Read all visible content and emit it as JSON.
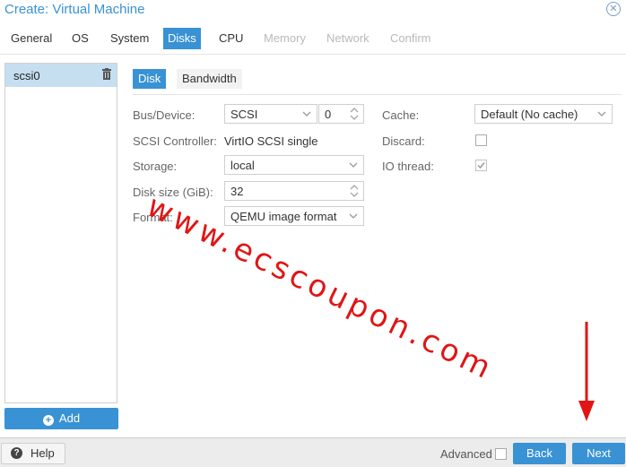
{
  "window": {
    "title": "Create: Virtual Machine",
    "close_icon": "close-icon"
  },
  "tabs": [
    {
      "label": "General",
      "state": "normal"
    },
    {
      "label": "OS",
      "state": "normal"
    },
    {
      "label": "System",
      "state": "normal"
    },
    {
      "label": "Disks",
      "state": "active"
    },
    {
      "label": "CPU",
      "state": "normal"
    },
    {
      "label": "Memory",
      "state": "disabled"
    },
    {
      "label": "Network",
      "state": "disabled"
    },
    {
      "label": "Confirm",
      "state": "disabled"
    }
  ],
  "disk_list": {
    "items": [
      {
        "label": "scsi0",
        "selected": true
      }
    ],
    "delete_icon": "trash-icon",
    "add_label": "Add",
    "add_icon": "plus-circle-icon"
  },
  "subtabs": [
    {
      "label": "Disk",
      "active": true
    },
    {
      "label": "Bandwidth",
      "active": false
    }
  ],
  "form": {
    "bus_device": {
      "label": "Bus/Device:",
      "bus_value": "SCSI",
      "device_value": "0"
    },
    "scsi_controller": {
      "label": "SCSI Controller:",
      "value": "VirtIO SCSI single"
    },
    "storage": {
      "label": "Storage:",
      "value": "local"
    },
    "disk_size": {
      "label": "Disk size (GiB):",
      "value": "32"
    },
    "format": {
      "label": "Format:",
      "value": "QEMU image format"
    },
    "cache": {
      "label": "Cache:",
      "value": "Default (No cache)"
    },
    "discard": {
      "label": "Discard:",
      "checked": false
    },
    "io_thread": {
      "label": "IO thread:",
      "checked": true,
      "disabled": true
    }
  },
  "watermark": "www.ecscoupon.com",
  "footer": {
    "help_label": "Help",
    "help_icon": "question-circle-icon",
    "advanced_label": "Advanced",
    "advanced_checked": false,
    "back_label": "Back",
    "next_label": "Next"
  },
  "colors": {
    "accent": "#3892d4",
    "selected_row": "#c5dff1",
    "watermark": "#e01515",
    "disabled_text": "#b9b9b9"
  }
}
